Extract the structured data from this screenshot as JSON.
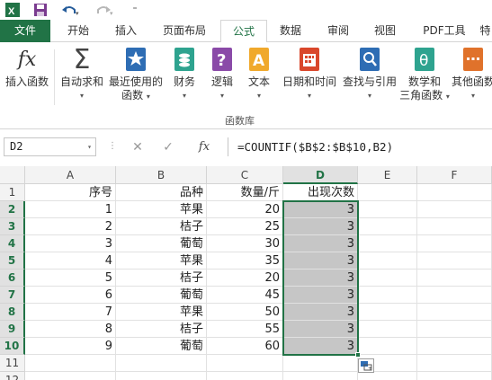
{
  "tabs": [
    "文件",
    "开始",
    "插入",
    "页面布局",
    "公式",
    "数据",
    "审阅",
    "视图",
    "PDF工具",
    "特"
  ],
  "ribbon": {
    "group_label": "函数库",
    "buttons": [
      {
        "l1": "插入函数",
        "l2": ""
      },
      {
        "l1": "自动求和",
        "l2": ""
      },
      {
        "l1": "最近使用的",
        "l2": "函数"
      },
      {
        "l1": "财务",
        "l2": ""
      },
      {
        "l1": "逻辑",
        "l2": ""
      },
      {
        "l1": "文本",
        "l2": ""
      },
      {
        "l1": "日期和时间",
        "l2": ""
      },
      {
        "l1": "查找与引用",
        "l2": ""
      },
      {
        "l1": "数学和",
        "l2": "三角函数"
      },
      {
        "l1": "其他函数",
        "l2": ""
      }
    ],
    "fx_glyph": "fx",
    "sum_glyph": "Σ",
    "logic_glyph": "?",
    "text_glyph": "A",
    "math_glyph": "θ"
  },
  "formula_bar": {
    "name_box": "D2",
    "fx_label": "fx",
    "cancel_glyph": "✕",
    "enter_glyph": "✓",
    "formula": "=COUNTIF($B$2:$B$10,B2)"
  },
  "sheet": {
    "columns": [
      "A",
      "B",
      "C",
      "D",
      "E",
      "F"
    ],
    "rows": [
      "1",
      "2",
      "3",
      "4",
      "5",
      "6",
      "7",
      "8",
      "9",
      "10",
      "11",
      "12"
    ],
    "header_row": [
      "序号",
      "品种",
      "数量/斤",
      "出现次数"
    ],
    "data": [
      [
        "1",
        "苹果",
        "20",
        "3"
      ],
      [
        "2",
        "桔子",
        "25",
        "3"
      ],
      [
        "3",
        "葡萄",
        "30",
        "3"
      ],
      [
        "4",
        "苹果",
        "35",
        "3"
      ],
      [
        "5",
        "桔子",
        "20",
        "3"
      ],
      [
        "6",
        "葡萄",
        "45",
        "3"
      ],
      [
        "7",
        "苹果",
        "50",
        "3"
      ],
      [
        "8",
        "桔子",
        "55",
        "3"
      ],
      [
        "9",
        "葡萄",
        "60",
        "3"
      ]
    ]
  },
  "colors": {
    "excel_green": "#217346",
    "selection_fill": "#c6c6c6"
  }
}
